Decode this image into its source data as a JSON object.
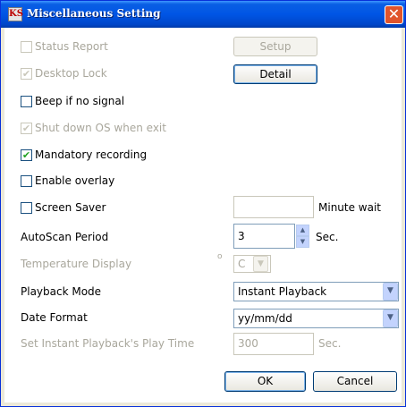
{
  "window": {
    "title": "Miscellaneous Setting",
    "icon_text": "KS",
    "close_glyph": "✕"
  },
  "options": {
    "status_report": {
      "label": "Status Report",
      "checked": false,
      "enabled": false
    },
    "desktop_lock": {
      "label": "Desktop Lock",
      "checked": true,
      "enabled": false
    },
    "beep_if_no_signal": {
      "label": "Beep if no signal",
      "checked": false,
      "enabled": true
    },
    "shut_down_os": {
      "label": "Shut down OS when exit",
      "checked": true,
      "enabled": false
    },
    "mandatory_recording": {
      "label": "Mandatory recording",
      "checked": true,
      "enabled": true
    },
    "enable_overlay": {
      "label": "Enable overlay",
      "checked": false,
      "enabled": true
    },
    "screen_saver": {
      "label": "Screen Saver",
      "checked": false,
      "enabled": true
    }
  },
  "buttons": {
    "setup": "Setup",
    "detail": "Detail",
    "ok": "OK",
    "cancel": "Cancel"
  },
  "screen_saver": {
    "value": "",
    "unit": "Minute wait"
  },
  "autoscan": {
    "label": "AutoScan Period",
    "value": "3",
    "unit": "Sec."
  },
  "temperature": {
    "label": "Temperature Display",
    "degree": "o",
    "value": "C"
  },
  "playback_mode": {
    "label": "Playback Mode",
    "value": "Instant Playback"
  },
  "date_format": {
    "label": "Date Format",
    "value": "yy/mm/dd"
  },
  "instant_playback_time": {
    "label": "Set Instant Playback's Play Time",
    "value": "300",
    "unit": "Sec."
  },
  "glyphs": {
    "check": "✔",
    "up": "▲",
    "down": "▼"
  },
  "colors": {
    "titlebar": "#0055e5",
    "close": "#e0542c",
    "check": "#21a121"
  }
}
